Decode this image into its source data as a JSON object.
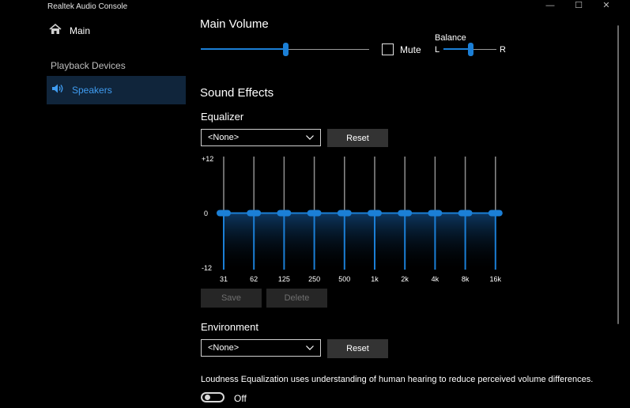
{
  "window": {
    "title": "Realtek Audio Console",
    "controls": {
      "minimize": "—",
      "maximize": "☐",
      "close": "✕"
    }
  },
  "sidebar": {
    "main_label": "Main",
    "section_label": "Playback Devices",
    "active_item_label": "Speakers"
  },
  "main_volume": {
    "heading": "Main Volume",
    "level_fraction": 0.5,
    "mute_label": "Mute",
    "mute_checked": false,
    "balance_label": "Balance",
    "balance_left": "L",
    "balance_right": "R",
    "balance_fraction": 0.5
  },
  "sound_effects": {
    "heading": "Sound Effects",
    "equalizer_label": "Equalizer",
    "equalizer_selected": "<None>",
    "reset_label": "Reset",
    "scale": {
      "top": "+12",
      "mid": "0",
      "bottom": "-12"
    },
    "bands": [
      "31",
      "62",
      "125",
      "250",
      "500",
      "1k",
      "2k",
      "4k",
      "8k",
      "16k"
    ],
    "band_values_db": [
      0,
      0,
      0,
      0,
      0,
      0,
      0,
      0,
      0,
      0
    ],
    "save_label": "Save",
    "delete_label": "Delete",
    "environment_label": "Environment",
    "environment_selected": "<None>",
    "environment_reset_label": "Reset"
  },
  "loudness": {
    "description": "Loudness Equalization uses understanding of human hearing to reduce perceived volume differences.",
    "state_label": "Off",
    "enabled": false
  },
  "colors": {
    "accent": "#1b7fd6",
    "active_nav_bg": "#10253b",
    "active_nav_text": "#3f9cf1"
  }
}
